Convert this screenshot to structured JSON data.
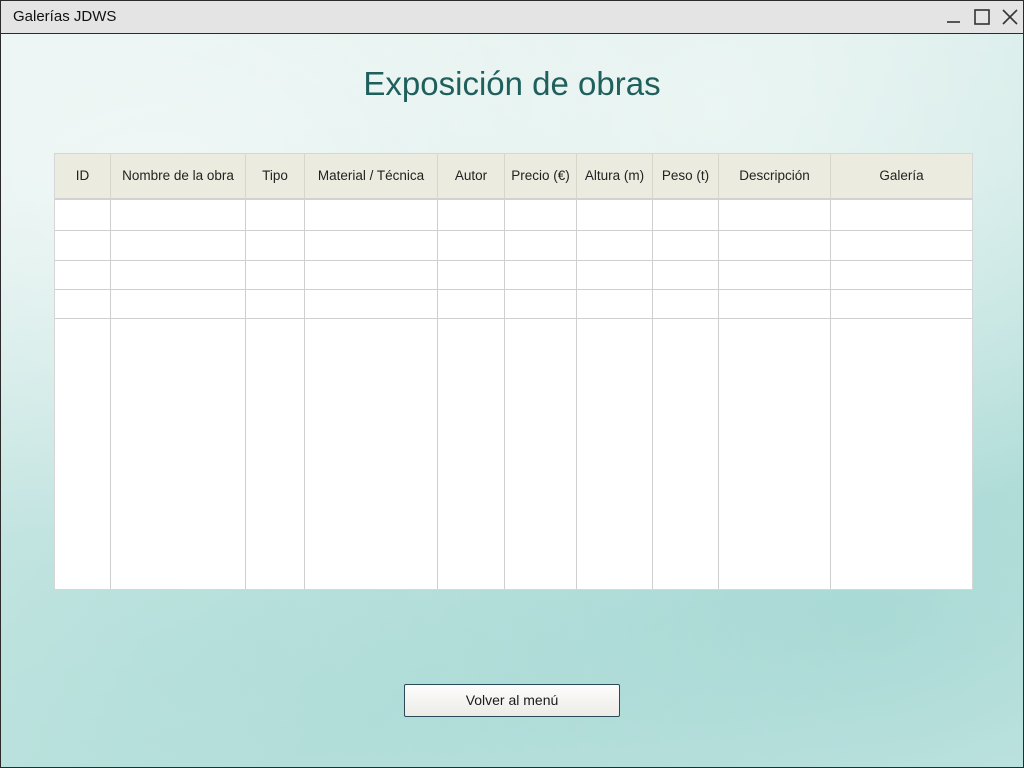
{
  "window": {
    "title": "Galerías JDWS"
  },
  "page": {
    "heading": "Exposición de obras"
  },
  "table": {
    "columns": [
      "ID",
      "Nombre de la obra",
      "Tipo",
      "Material / Técnica",
      "Autor",
      "Precio (€)",
      "Altura (m)",
      "Peso (t)",
      "Descripción",
      "Galería"
    ],
    "rows": []
  },
  "actions": {
    "back_label": "Volver al menú"
  },
  "colors": {
    "heading": "#1f5f5c",
    "header_bg": "#ecebdf",
    "titlebar_bg": "#e4e4e4"
  }
}
